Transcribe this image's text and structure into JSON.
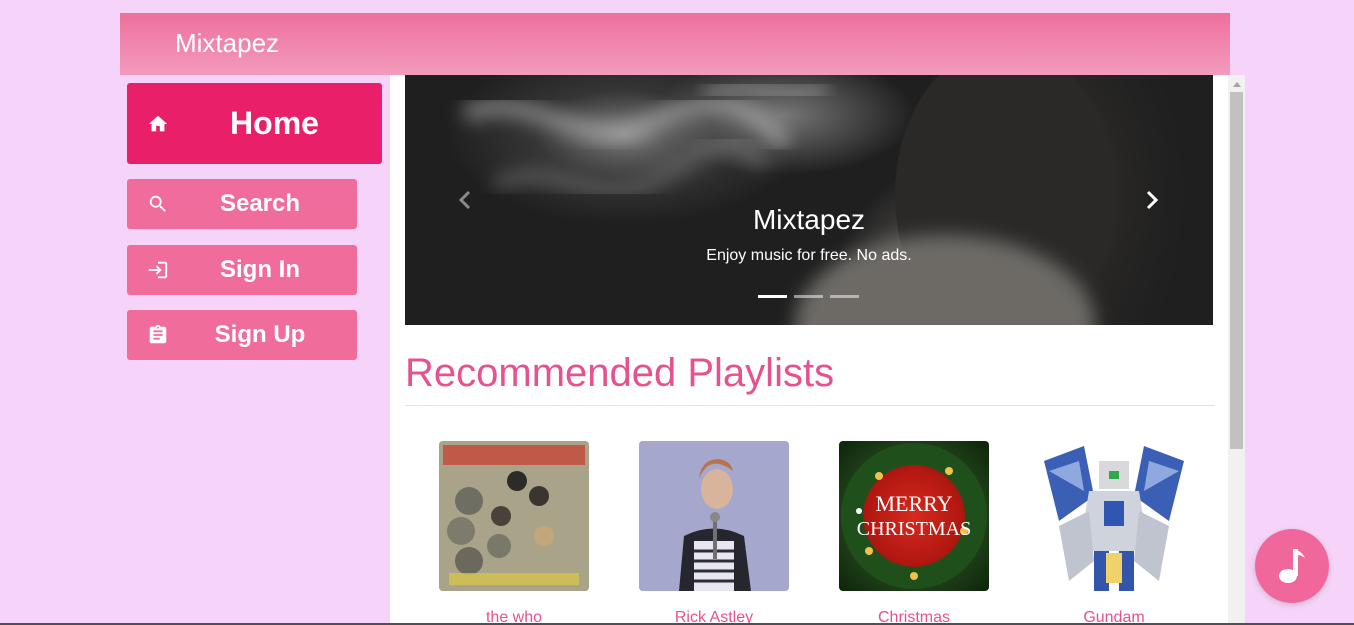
{
  "navbar": {
    "brand": "Mixtapez"
  },
  "sidebar": {
    "items": [
      {
        "label": "Home",
        "icon": "home-icon",
        "active": true
      },
      {
        "label": "Search",
        "icon": "search-icon"
      },
      {
        "label": "Sign In",
        "icon": "sign-in-icon"
      },
      {
        "label": "Sign Up",
        "icon": "clipboard-icon"
      }
    ]
  },
  "carousel": {
    "title": "Mixtapez",
    "subtitle": "Enjoy music for free. No ads.",
    "slide_count": 3,
    "active_slide": 1
  },
  "main": {
    "section_title": "Recommended Playlists",
    "playlists": [
      {
        "name": "the who"
      },
      {
        "name": "Rick Astley"
      },
      {
        "name": "Christmas"
      },
      {
        "name": "Gundam"
      }
    ]
  },
  "colors": {
    "page_bg": "#f6d3f8",
    "accent": "#e5528f",
    "home_button": "#ea1f6a",
    "nav_button": "#f06c9b"
  },
  "fab": {
    "icon": "music-note-icon"
  }
}
